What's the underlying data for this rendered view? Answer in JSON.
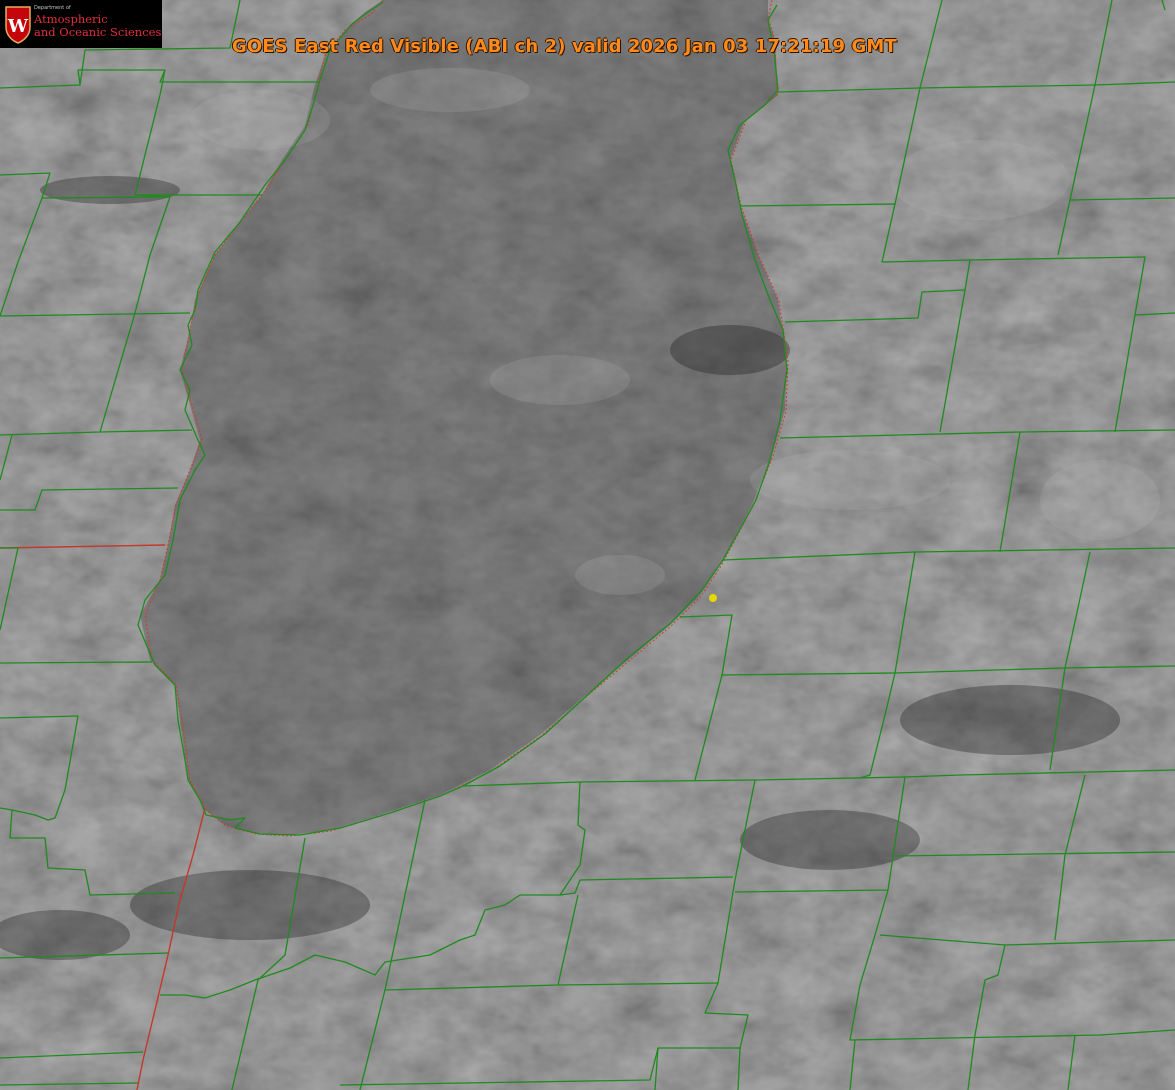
{
  "title": "GOES East Red Visible (ABI ch 2) valid 2026 Jan 03 17:21:19 GMT",
  "logo": {
    "emblem": "W",
    "department_label": "Department of",
    "line1": "Atmospheric",
    "line2": "and Oceanic Sciences"
  },
  "map": {
    "imagery": "satellite visible reflectance, grayscale, cloud cover over land and lake",
    "boundary_color": "#1f8a1f",
    "lake_outline_color": "#d33a2a",
    "marker_color": "#e6d800",
    "background_color": "#5a5a5a"
  }
}
